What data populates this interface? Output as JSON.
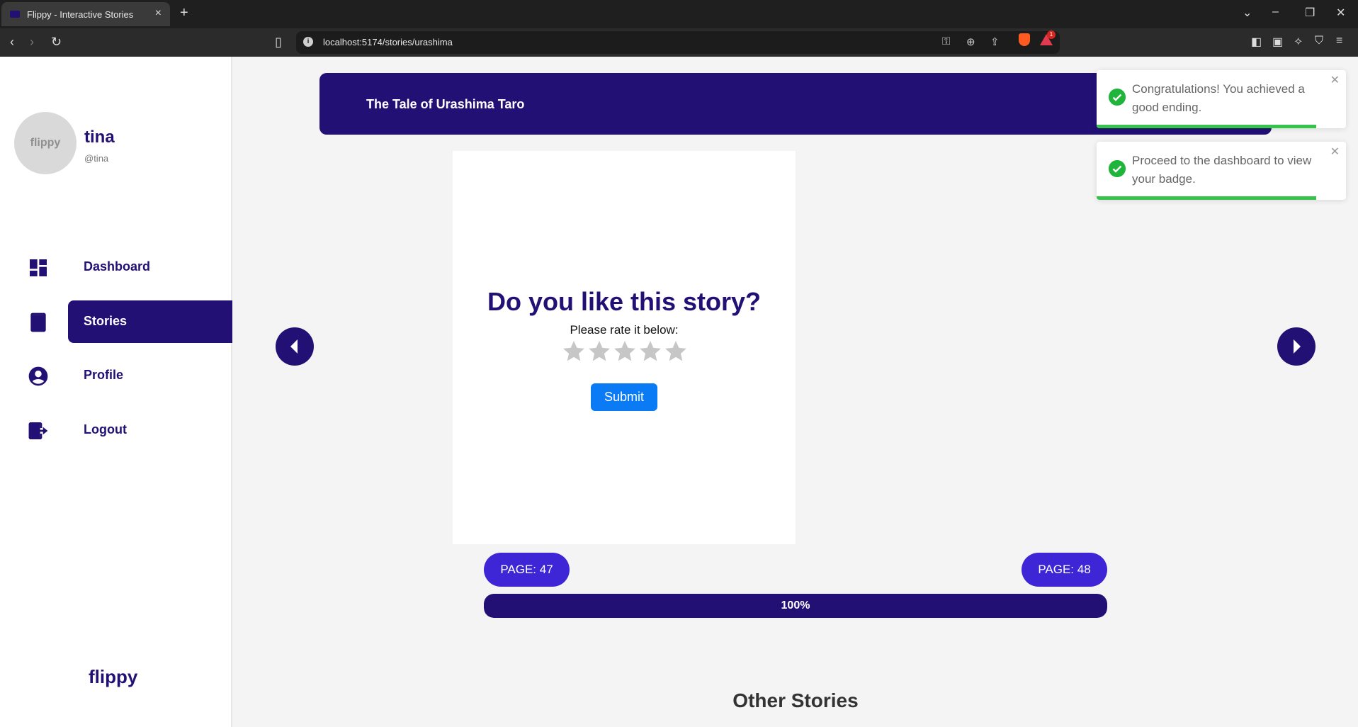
{
  "browser": {
    "tab_title": "Flippy - Interactive Stories",
    "url": "localhost:5174/stories/urashima",
    "rewards_count": "1"
  },
  "sidebar": {
    "avatar_text": "flippy",
    "username": "tina",
    "handle": "@tina",
    "items": [
      {
        "label": "Dashboard",
        "icon": "dashboard-icon",
        "active": false
      },
      {
        "label": "Stories",
        "icon": "book-icon",
        "active": true
      },
      {
        "label": "Profile",
        "icon": "account-circle-icon",
        "active": false
      },
      {
        "label": "Logout",
        "icon": "logout-icon",
        "active": false
      }
    ],
    "brand": "flippy"
  },
  "story": {
    "title": "The Tale of Urashima Taro",
    "question": "Do you like this story?",
    "prompt": "Please rate it below:",
    "rating": 0,
    "max_rating": 5,
    "submit_label": "Submit"
  },
  "pager": {
    "left_page": "PAGE: 47",
    "right_page": "PAGE: 48",
    "progress_text": "100%",
    "progress_fraction": 1.0
  },
  "other_stories_title": "Other Stories",
  "toasts": [
    {
      "message": "Congratulations! You achieved a good ending.",
      "remaining_fraction": 0.88
    },
    {
      "message": "Proceed to the dashboard to view your badge.",
      "remaining_fraction": 0.88
    }
  ],
  "colors": {
    "brand_dark": "#231075",
    "page_pill": "#3e25d6",
    "submit_blue": "#0b7bf5",
    "toast_green": "#1fb53a",
    "star_empty": "#c6c6c6"
  }
}
